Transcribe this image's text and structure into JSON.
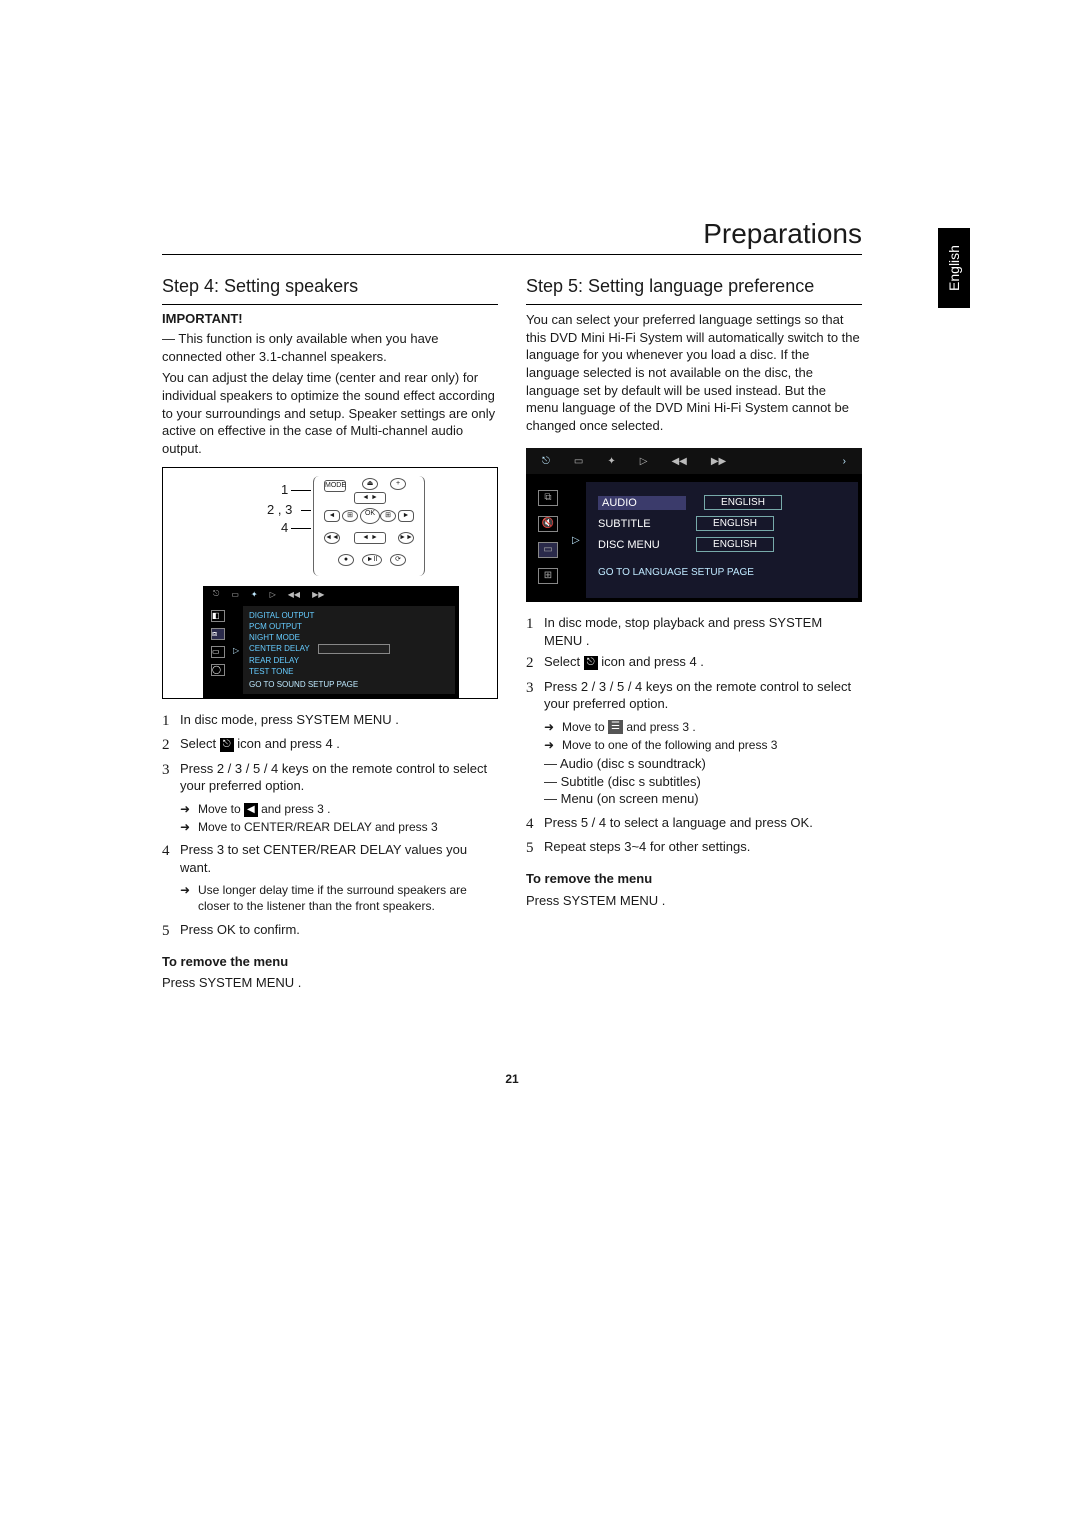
{
  "sideTab": "English",
  "chapter": "Preparations",
  "pageNumber": "21",
  "left": {
    "stepTitle": "Step 4:   Setting speakers",
    "importantLabel": "IMPORTANT!",
    "importantText": "— This function is only available when you have connected other 3.1-channel speakers.",
    "intro": "You can adjust the delay time (center and rear only) for individual speakers to optimize the sound effect according to your surroundings and setup. Speaker settings are only active on effective in the case of  Multi-channel audio output.",
    "callouts": {
      "c1": "1",
      "c2": "2 , 3",
      "c3": "4"
    },
    "menu": {
      "items": [
        "DIGITAL OUTPUT",
        "PCM OUTPUT",
        "NIGHT MODE",
        "CENTER DELAY",
        "REAR DELAY",
        "TEST TONE"
      ],
      "footer": "GO TO SOUND SETUP PAGE"
    },
    "steps": {
      "s1": "In disc mode, press SYSTEM MENU .",
      "s2a": "Select ",
      "s2b": " icon and press 4 .",
      "s3": "Press 2  / 3  / 5  / 4  keys on the remote control to select your preferred option.",
      "s3suba": "Move to ",
      "s3subb": " and press 3 .",
      "s3subc": "Move to  CENTER/REAR DELAY  and press 3",
      "s4a": "Press 3  to set CENTER/REAR DELAY values you want.",
      "s4b": "Use longer delay time if the surround speakers are closer to the listener than the front speakers.",
      "s5": "Press OK  to confirm.",
      "remove1": "To  remove the menu",
      "remove2": "Press SYSTEM MENU ."
    }
  },
  "right": {
    "stepTitle": "Step 5:   Setting language preference",
    "intro": "You can select your preferred language settings so that this DVD Mini Hi-Fi System will automatically switch to the language for you whenever you load a disc. If the language selected is not available on the disc, the language set by default will be used instead. But the menu language of the DVD Mini Hi-Fi System cannot be changed once selected.",
    "menu": {
      "rows": [
        {
          "label": "AUDIO",
          "value": "ENGLISH"
        },
        {
          "label": "SUBTITLE",
          "value": "ENGLISH"
        },
        {
          "label": "DISC MENU",
          "value": "ENGLISH"
        }
      ],
      "footer": "GO TO LANGUAGE SETUP PAGE"
    },
    "steps": {
      "s1": "In disc mode, stop playback and press SYSTEM MENU .",
      "s2a": "Select ",
      "s2b": " icon and press 4 .",
      "s3": "Press 2  / 3  / 5  / 4  keys on the remote control to select your preferred option.",
      "s3suba": "Move to ",
      "s3subb": " and press 3 .",
      "s3subc": "Move to one of the following and press 3",
      "note1": "— Audio (disc s soundtrack)",
      "note2": "— Subtitle (disc s subtitles)",
      "note3": "— Menu (on screen menu)",
      "s4": "Press 5  /  4  to select a language and press OK.",
      "s5": "Repeat steps 3~4 for other settings.",
      "remove1": "To  remove the menu",
      "remove2": "Press SYSTEM MENU ."
    }
  }
}
